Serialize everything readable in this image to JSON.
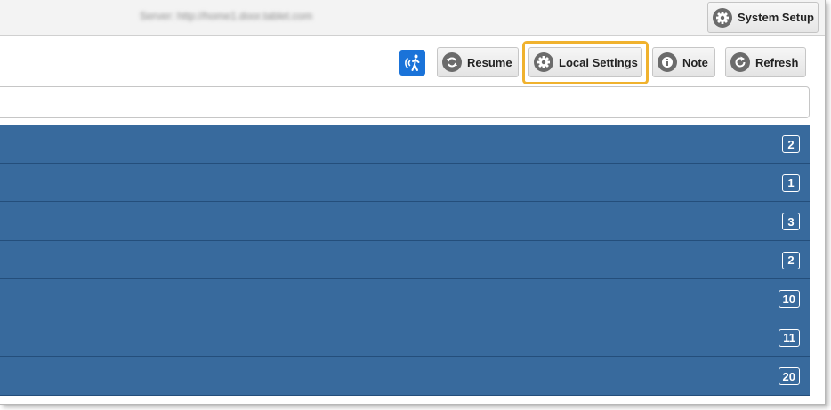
{
  "topbar": {
    "server_text": "Server: http://home1.door.tablet.com",
    "system_setup_label": "System Setup"
  },
  "toolbar": {
    "accessibility_icon": "accessibility-icon",
    "resume_label": "Resume",
    "local_settings_label": "Local Settings",
    "note_label": "Note",
    "refresh_label": "Refresh"
  },
  "search": {
    "value": "",
    "placeholder": ""
  },
  "list": {
    "items": [
      {
        "count": "2"
      },
      {
        "count": "1"
      },
      {
        "count": "3"
      },
      {
        "count": "2"
      },
      {
        "count": "10"
      },
      {
        "count": "11"
      },
      {
        "count": "20"
      }
    ]
  },
  "colors": {
    "row_background": "#386a9d",
    "highlight": "#f0b22e",
    "accessibility_blue": "#1a73d9"
  }
}
